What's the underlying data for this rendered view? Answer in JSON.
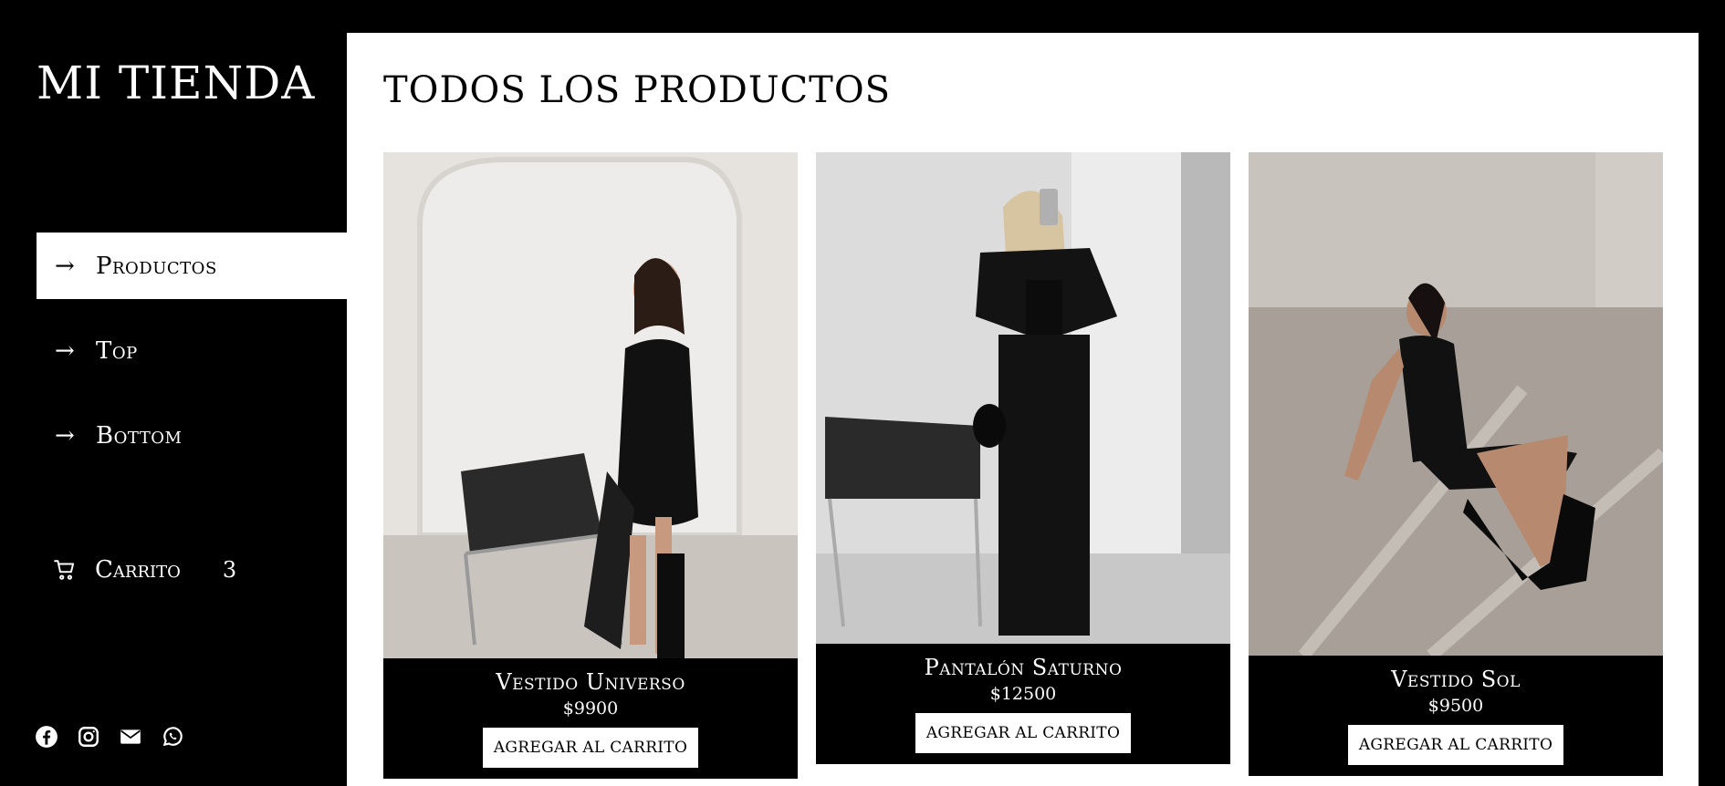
{
  "sidebar": {
    "brand": "MI TIENDA",
    "nav": [
      {
        "label": "Productos",
        "active": true
      },
      {
        "label": "Top",
        "active": false
      },
      {
        "label": "Bottom",
        "active": false
      }
    ],
    "cart": {
      "label": "Carrito",
      "count": "3"
    },
    "social_icons": [
      "facebook-icon",
      "instagram-icon",
      "mail-icon",
      "whatsapp-icon"
    ]
  },
  "main": {
    "title": "TODOS LOS PRODUCTOS",
    "products": [
      {
        "name": "Vestido Universo",
        "price": "$9900",
        "button": "AGREGAR AL CARRITO"
      },
      {
        "name": "Pantalón Saturno",
        "price": "$12500",
        "button": "AGREGAR AL CARRITO"
      },
      {
        "name": "Vestido Sol",
        "price": "$9500",
        "button": "AGREGAR AL CARRITO"
      }
    ]
  },
  "colors": {
    "background": "#000000",
    "panel": "#ffffff",
    "accent": "#000000"
  }
}
